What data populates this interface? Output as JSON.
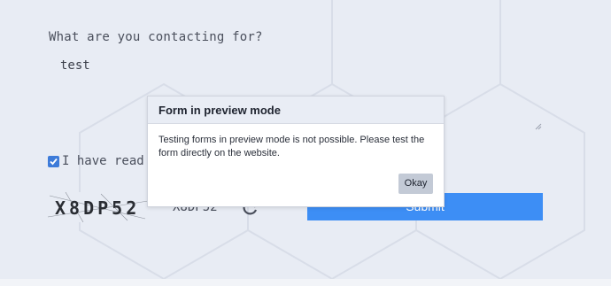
{
  "form": {
    "question_label": "What are you contacting for?",
    "message_value": "test",
    "agree_label": "I have read and",
    "agree_checked": true,
    "captcha_code": "X8DP52",
    "captcha_image_text": "X8DP52",
    "submit_label": "Submit"
  },
  "dialog": {
    "title": "Form in preview mode",
    "message": "Testing forms in preview mode is not possible. Please test the form directly on the website.",
    "ok_label": "Okay"
  },
  "colors": {
    "background": "#e8ecf4",
    "accent": "#3d8ef5",
    "checkbox": "#3d7bd9"
  }
}
